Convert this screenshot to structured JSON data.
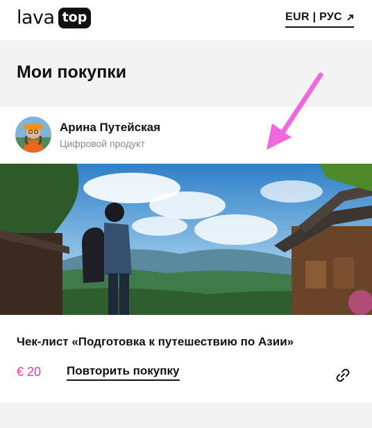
{
  "header": {
    "logo_main": "lava",
    "logo_badge": "top",
    "lang_switch": "EUR | РУС",
    "lang_icon": "arrow-up-right-icon"
  },
  "page": {
    "title": "Мои покупки"
  },
  "purchase": {
    "author_name": "Арина Путейская",
    "author_subtitle": "Цифровой продукт",
    "product_title": "Чек-лист «Подготовка к путешествию по Азии»",
    "price": "€ 20",
    "repeat_label": "Повторить покупку",
    "link_icon": "link-icon"
  },
  "colors": {
    "accent_price": "#e03fb3",
    "annotation_arrow": "#f266df"
  }
}
